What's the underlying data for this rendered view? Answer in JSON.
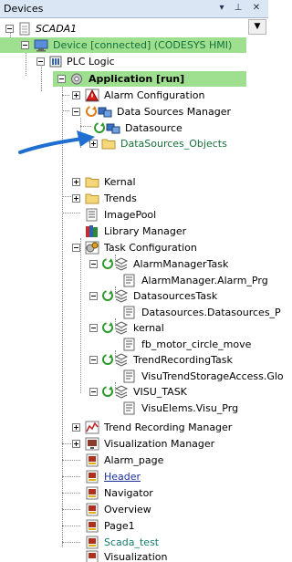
{
  "panel": {
    "title": "Devices",
    "controls": [
      "▾",
      "⊥",
      "✕"
    ]
  },
  "colors": {
    "selection_bg": "#9ee08f",
    "title_bg": "#dbe6f4",
    "arrow": "#1f6fd0",
    "green_text": "#15703a",
    "link_text": "#1a2f9a"
  },
  "tree": {
    "scada1": "SCADA1",
    "device": "Device [connected] (CODESYS HMI)",
    "plc_logic": "PLC Logic",
    "application": "Application [run]",
    "alarm_configuration": "Alarm Configuration",
    "data_sources_manager": "Data Sources Manager",
    "datasource": "Datasource",
    "datasources_objects": "DataSources_Objects",
    "kernal": "Kernal",
    "trends": "Trends",
    "imagepool": "ImagePool",
    "library_manager": "Library Manager",
    "task_configuration": "Task Configuration",
    "alarm_manager_task": "AlarmManagerTask",
    "alarm_manager_prg": "AlarmManager.Alarm_Prg",
    "datasources_task": "DatasourcesTask",
    "datasources_prg": "Datasources.Datasources_P",
    "kernel": "kernal",
    "fb_motor": "fb_motor_circle_move",
    "trend_recording_task": "TrendRecordingTask",
    "visu_trend_storage": "VisuTrendStorageAccess.Glo",
    "visu_task": "VISU_TASK",
    "visu_elems": "VisuElems.Visu_Prg",
    "trend_recording_manager": "Trend Recording Manager",
    "visualization_manager": "Visualization Manager",
    "alarm_page": "Alarm_page",
    "header": "Header",
    "navigator": "Navigator",
    "overview": "Overview",
    "page1": "Page1",
    "scada_test": "Scada_test",
    "visualization": "Visualization"
  }
}
